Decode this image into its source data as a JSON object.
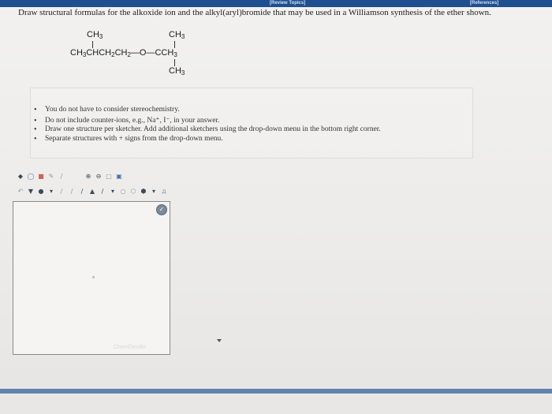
{
  "header": {
    "review_topics": "[Review Topics]",
    "references": "[References]"
  },
  "question": "Draw structural formulas for the alkoxide ion and the alkyl(aryl)bromide that may be used in a Williamson synthesis of the ether shown.",
  "molecule": {
    "left_branch": "CH3",
    "right_branch_top": "CH3",
    "right_branch_bottom": "CH3",
    "main_chain": "CH3CHCH2CH2—O—CCH3"
  },
  "instructions": [
    "You do not have to consider stereochemistry.",
    "Do not include counter-ions, e.g., Na⁺, I⁻, in your answer.",
    "Draw one structure per sketcher. Add additional sketchers using the drop-down menu in the bottom right corner.",
    "Separate structures with + signs from the drop-down menu."
  ],
  "toolbar": {
    "row1_icons": [
      "select-icon",
      "lasso-icon",
      "eraser-icon",
      "pencil-icon",
      "bond-icon",
      "zoom-in-icon",
      "zoom-out-icon",
      "copy-icon",
      "paste-icon"
    ],
    "row2_icons": [
      "undo-icon",
      "charge-icon",
      "single-bond-icon",
      "double-bond-icon",
      "triple-bond-icon",
      "wedge-bond-icon",
      "hash-bond-icon",
      "dropdown-icon",
      "cyclopropane-icon",
      "cyclohexane-icon",
      "benzene-icon",
      "dropdown-icon",
      "atom-icon"
    ]
  },
  "sketcher": {
    "ghost_label": "ChemDoodle"
  }
}
